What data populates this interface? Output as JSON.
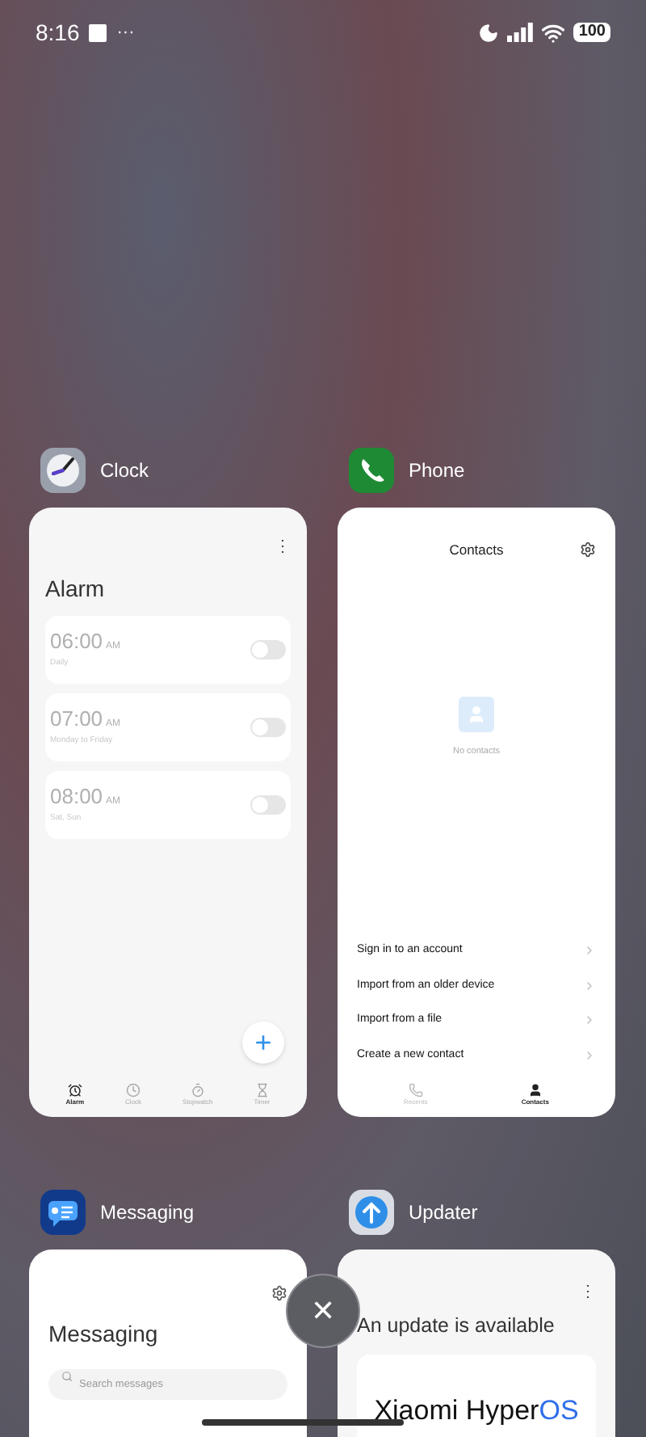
{
  "status_bar": {
    "time": "8:16",
    "more": "···",
    "battery": "100"
  },
  "apps": [
    {
      "kind": "clock",
      "name": "Clock",
      "menu": "⋮",
      "title": "Alarm",
      "alarms": [
        {
          "time": "06:00",
          "ampm": "AM",
          "repeat": "Daily",
          "on": false
        },
        {
          "time": "07:00",
          "ampm": "AM",
          "repeat": "Monday to Friday",
          "on": false
        },
        {
          "time": "08:00",
          "ampm": "AM",
          "repeat": "Sat, Sun",
          "on": false
        }
      ],
      "fab": "+",
      "tabs": [
        {
          "label": "Alarm",
          "selected": true
        },
        {
          "label": "Clock",
          "selected": false
        },
        {
          "label": "Stopwatch",
          "selected": false
        },
        {
          "label": "Timer",
          "selected": false
        }
      ]
    },
    {
      "kind": "phone",
      "name": "Phone",
      "title": "Contacts",
      "empty": "No contacts",
      "actions": [
        "Sign in to an account",
        "Import from an older device",
        "Import from a file",
        "Create a new contact"
      ],
      "tabs": [
        {
          "label": "Recents",
          "selected": false
        },
        {
          "label": "Contacts",
          "selected": true
        }
      ]
    },
    {
      "kind": "messaging",
      "name": "Messaging",
      "title": "Messaging",
      "search": {
        "placeholder": "Search messages"
      }
    },
    {
      "kind": "updater",
      "name": "Updater",
      "menu": "⋮",
      "title": "An update is available",
      "brand": "Xiaomi Hyper",
      "brand_accent": "OS"
    }
  ],
  "close": "✕"
}
